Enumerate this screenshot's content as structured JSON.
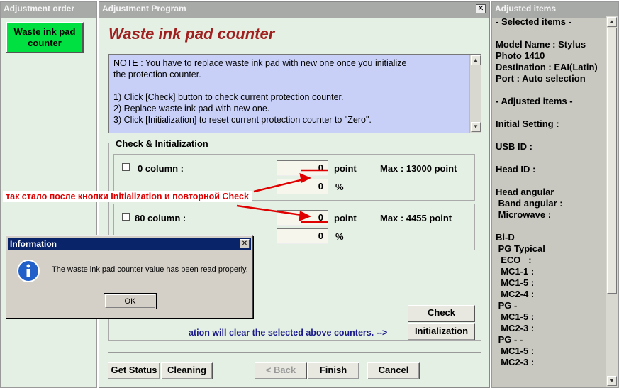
{
  "left_panel": {
    "title": "Adjustment order",
    "active_item": "Waste ink pad counter"
  },
  "main_window": {
    "title": "Adjustment Program",
    "heading": "Waste ink pad counter",
    "note_lines": [
      "NOTE : You have to replace waste ink pad with new one once you initialize",
      "the protection counter.",
      "",
      "1) Click [Check] button to check current protection counter.",
      "2) Replace waste ink pad with new one.",
      "3) Click [Initialization] to reset current protection counter to \"Zero\"."
    ],
    "group_title": "Check & Initialization",
    "rows": [
      {
        "label": "0 column :",
        "point_value": "0",
        "point_unit": "point",
        "max_text": "Max : 13000 point",
        "percent_value": "0",
        "percent_unit": "%"
      },
      {
        "label": "80 column :",
        "point_value": "0",
        "point_unit": "point",
        "max_text": "Max : 4455 point",
        "percent_value": "0",
        "percent_unit": "%"
      }
    ],
    "check_button": "Check",
    "init_hint": "ation will clear the selected above counters. -->",
    "init_button": "Initialization",
    "bottom_buttons": {
      "get_status": "Get Status",
      "cleaning": "Cleaning",
      "back": "< Back",
      "finish": "Finish",
      "cancel": "Cancel"
    }
  },
  "annotation": {
    "text": "так стало после кнопки Initialization и повторной Check",
    "color": "#e00000"
  },
  "dialog": {
    "title": "Information",
    "message": "The waste ink pad counter value has been read properly.",
    "ok_label": "OK",
    "icon": "info-icon"
  },
  "right_panel": {
    "title": "Adjusted items",
    "lines": [
      "- Selected items -",
      "",
      "Model Name : Stylus",
      "Photo 1410",
      "Destination : EAI(Latin)",
      "Port : Auto selection",
      "",
      "- Adjusted items -",
      "",
      "Initial Setting :",
      "",
      "USB ID :",
      "",
      "Head ID :",
      "",
      "Head angular",
      " Band angular :",
      " Microwave :",
      "",
      "Bi-D",
      " PG Typical",
      "  ECO   :",
      "  MC1-1 :",
      "  MC1-5 :",
      "  MC2-4 :",
      " PG -",
      "  MC1-5 :",
      "  MC2-3 :",
      " PG - -",
      "  MC1-5 :",
      "  MC2-3 :"
    ]
  },
  "colors": {
    "panel_bg": "#e4f0e4",
    "note_bg": "#c8d0f8",
    "heading": "#a02020",
    "active_item": "#00e040",
    "dialog_title": "#0a246a"
  }
}
